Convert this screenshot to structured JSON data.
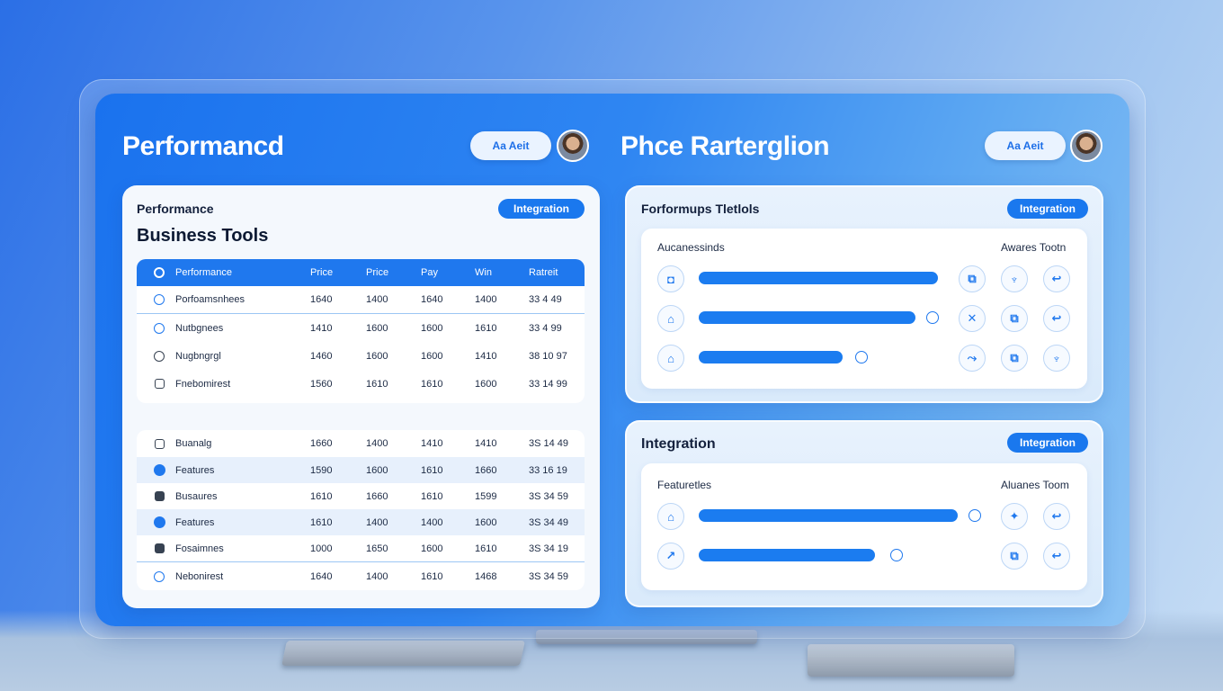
{
  "header_left": {
    "title": "Performancd",
    "button": "Aa Aeit"
  },
  "header_right": {
    "title": "Phce Rarterglion",
    "button": "Aa Aeit"
  },
  "left_card": {
    "label": "Performance",
    "badge": "Integration",
    "heading": "Business Tools"
  },
  "table1": {
    "headers": [
      "Performance",
      "Price",
      "Price",
      "Pay",
      "Win",
      "Ratreit"
    ],
    "rows": [
      {
        "name": "Porfoamsnhees",
        "v": [
          "1640",
          "1400",
          "1640",
          "1400",
          "33 4 49"
        ]
      },
      {
        "name": "Nutbgnees",
        "v": [
          "1410",
          "1600",
          "1600",
          "1610",
          "33 4 99"
        ]
      },
      {
        "name": "Nugbngrgl",
        "v": [
          "1460",
          "1600",
          "1600",
          "1410",
          "38 10 97"
        ]
      },
      {
        "name": "Fnebomirest",
        "v": [
          "1560",
          "1610",
          "1610",
          "1600",
          "33 14 99"
        ]
      }
    ]
  },
  "table2": {
    "rows": [
      {
        "name": "Buanalg",
        "v": [
          "1660",
          "1400",
          "1410",
          "1410",
          "3S 14 49"
        ]
      },
      {
        "name": "Features",
        "v": [
          "1590",
          "1600",
          "1610",
          "1660",
          "33 16 19"
        ]
      },
      {
        "name": "Busaures",
        "v": [
          "1610",
          "1660",
          "1610",
          "1599",
          "3S 34 59"
        ]
      },
      {
        "name": "Features",
        "v": [
          "1610",
          "1400",
          "1400",
          "1600",
          "3S 34 49"
        ]
      },
      {
        "name": "Fosaimnes",
        "v": [
          "1000",
          "1650",
          "1600",
          "1610",
          "3S 34 19"
        ]
      },
      {
        "name": "Nebonirest",
        "v": [
          "1640",
          "1400",
          "1610",
          "1468",
          "3S 34 59"
        ]
      }
    ]
  },
  "right_top": {
    "label": "Forformups Tletlols",
    "badge": "Integration",
    "left_caption": "Aucanessinds",
    "right_caption": "Awares Tootn",
    "rows": [
      {
        "fill": 0.95,
        "icons": [
          "⧉",
          "♆",
          "↩"
        ]
      },
      {
        "fill": 0.86,
        "icons": [
          "✕",
          "⧉",
          "↩"
        ]
      },
      {
        "fill": 0.57,
        "icons": [
          "⤳",
          "⧉",
          "♆"
        ]
      }
    ]
  },
  "right_bottom": {
    "label": "Integration",
    "badge": "Integration",
    "left_caption": "Featuretles",
    "right_caption": "Aluanes Toom",
    "rows": [
      {
        "fill": 1.0,
        "icons": [
          "✦",
          "↩"
        ]
      },
      {
        "fill": 0.68,
        "icons": [
          "⧉",
          "↩"
        ]
      }
    ]
  },
  "colors": {
    "accent": "#1f78ee",
    "board": "#1a72ee",
    "card": "#f4f8fd"
  }
}
